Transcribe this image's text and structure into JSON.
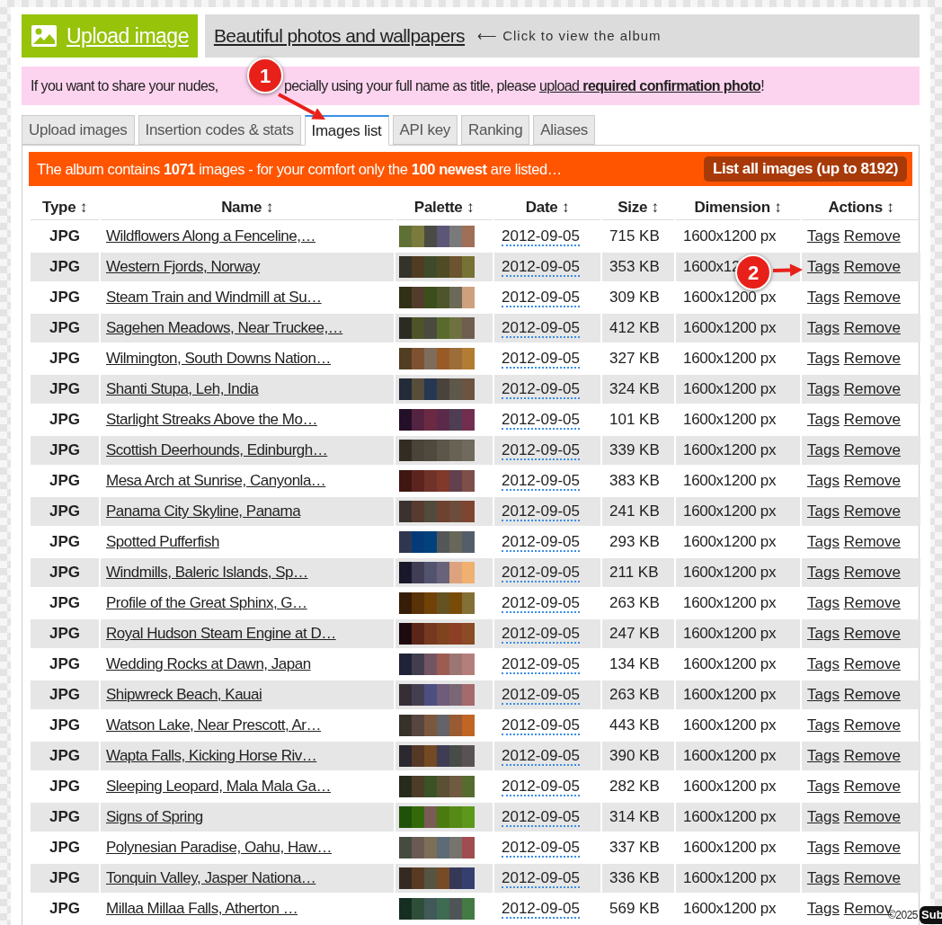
{
  "header": {
    "upload_button": "Upload image",
    "album_title": "Beautiful photos and wallpapers",
    "album_hint": "⟵ Click to view the album"
  },
  "notice": {
    "before_marker": "If you want to share your nudes,",
    "after_marker": "pecially using your full name as title, please",
    "link": "upload **required confirmation photo**",
    "end": "!"
  },
  "tabs": [
    {
      "label": "Upload images",
      "selected": false
    },
    {
      "label": "Insertion codes & stats",
      "selected": false
    },
    {
      "label": "Images list",
      "selected": true
    },
    {
      "label": "API key",
      "selected": false
    },
    {
      "label": "Ranking",
      "selected": false
    },
    {
      "label": "Aliases",
      "selected": false
    }
  ],
  "album_bar": {
    "text": "The album contains **1071** images - for your comfort only the **100 newest** are listed…",
    "button": "List all images (up to 8192)"
  },
  "table": {
    "columns": [
      "Type ↕",
      "Name ↕",
      "Palette ↕",
      "Date ↕",
      "Size ↕",
      "Dimension ↕",
      "Actions ↕"
    ],
    "rows": [
      {
        "type": "JPG",
        "name": "Wildflowers Along a Fenceline,…",
        "palette": [
          {
            "color": "#5f7035"
          },
          {
            "color": "#7a7b3c"
          },
          {
            "color": "#4b4b45"
          },
          {
            "color": "#5c5677"
          },
          {
            "color": "#7a7a7a"
          },
          {
            "color": "#a06f58"
          }
        ],
        "date": "2012-09-05",
        "size": "715 KB",
        "dimension": "1600x1200 px",
        "tags": "Tags",
        "remove": "Remove"
      },
      {
        "type": "JPG",
        "name": "Western Fjords, Norway",
        "palette": [
          {
            "color": "#33332a"
          },
          {
            "color": "#503c22"
          },
          {
            "color": "#3f4a2b"
          },
          {
            "color": "#514b25"
          },
          {
            "color": "#6b542f"
          },
          {
            "color": "#757234"
          }
        ],
        "date": "2012-09-05",
        "size": "353 KB",
        "dimension": "1600x12",
        "tags": "Tags",
        "remove": "Remove"
      },
      {
        "type": "JPG",
        "name": "Steam Train and Windmill at Su…",
        "palette": [
          {
            "color": "#313016"
          },
          {
            "color": "#523d2c"
          },
          {
            "color": "#3b4e1c"
          },
          {
            "color": "#4e552c"
          },
          {
            "color": "#6b6a58"
          },
          {
            "color": "#cda07e"
          }
        ],
        "date": "2012-09-05",
        "size": "309 KB",
        "dimension": "1600x1200 px",
        "tags": "Tags",
        "remove": "Remove"
      },
      {
        "type": "JPG",
        "name": "Sagehen Meadows, Near Truckee,…",
        "palette": [
          {
            "color": "#2b2b22"
          },
          {
            "color": "#4f5328"
          },
          {
            "color": "#4b4a40"
          },
          {
            "color": "#5a6a2c"
          },
          {
            "color": "#6f7141"
          },
          {
            "color": "#6f5e50"
          }
        ],
        "date": "2012-09-05",
        "size": "412 KB",
        "dimension": "1600x1200 px",
        "tags": "Tags",
        "remove": "Remove"
      },
      {
        "type": "JPG",
        "name": "Wilmington, South Downs Nation…",
        "palette": [
          {
            "color": "#513d22"
          },
          {
            "color": "#7e5230"
          },
          {
            "color": "#7e6d5c"
          },
          {
            "color": "#9a5a26"
          },
          {
            "color": "#9c6d38"
          },
          {
            "color": "#b27c33"
          }
        ],
        "date": "2012-09-05",
        "size": "327 KB",
        "dimension": "1600x1200 px",
        "tags": "Tags",
        "remove": "Remove"
      },
      {
        "type": "JPG",
        "name": "Shanti Stupa, Leh, India",
        "palette": [
          {
            "color": "#222b37"
          },
          {
            "color": "#564d3b"
          },
          {
            "color": "#263752"
          },
          {
            "color": "#4a433d"
          },
          {
            "color": "#5d584a"
          },
          {
            "color": "#6b5442"
          }
        ],
        "date": "2012-09-05",
        "size": "324 KB",
        "dimension": "1600x1200 px",
        "tags": "Tags",
        "remove": "Remove"
      },
      {
        "type": "JPG",
        "name": "Starlight Streaks Above the Mo…",
        "palette": [
          {
            "color": "#231028"
          },
          {
            "color": "#532341"
          },
          {
            "color": "#6c2a42"
          },
          {
            "color": "#5b2a4b"
          },
          {
            "color": "#4f3e53"
          },
          {
            "color": "#722e4f"
          }
        ],
        "date": "2012-09-05",
        "size": "101 KB",
        "dimension": "1600x1200 px",
        "tags": "Tags",
        "remove": "Remove"
      },
      {
        "type": "JPG",
        "name": "Scottish Deerhounds, Edinburgh…",
        "palette": [
          {
            "color": "#322c23"
          },
          {
            "color": "#49433a"
          },
          {
            "color": "#4f493e"
          },
          {
            "color": "#5b5649"
          },
          {
            "color": "#676254"
          },
          {
            "color": "#6f6a5d"
          }
        ],
        "date": "2012-09-05",
        "size": "339 KB",
        "dimension": "1600x1200 px",
        "tags": "Tags",
        "remove": "Remove"
      },
      {
        "type": "JPG",
        "name": "Mesa Arch at Sunrise, Canyonla…",
        "palette": [
          {
            "color": "#3f1611"
          },
          {
            "color": "#5d241f"
          },
          {
            "color": "#703229"
          },
          {
            "color": "#80392a"
          },
          {
            "color": "#62404d"
          },
          {
            "color": "#7e4e49"
          }
        ],
        "date": "2012-09-05",
        "size": "383 KB",
        "dimension": "1600x1200 px",
        "tags": "Tags",
        "remove": "Remove"
      },
      {
        "type": "JPG",
        "name": "Panama City Skyline, Panama",
        "palette": [
          {
            "color": "#3b3230"
          },
          {
            "color": "#583b2f"
          },
          {
            "color": "#504b3c"
          },
          {
            "color": "#6d4330"
          },
          {
            "color": "#6d4c3c"
          },
          {
            "color": "#7e4630"
          }
        ],
        "date": "2012-09-05",
        "size": "241 KB",
        "dimension": "1600x1200 px",
        "tags": "Tags",
        "remove": "Remove"
      },
      {
        "type": "JPG",
        "name": "Spotted Pufferfish",
        "palette": [
          {
            "color": "#2f3750"
          },
          {
            "color": "#043a77"
          },
          {
            "color": "#03417d"
          },
          {
            "color": "#545658"
          },
          {
            "color": "#676859"
          },
          {
            "color": "#545e6b"
          }
        ],
        "date": "2012-09-05",
        "size": "293 KB",
        "dimension": "1600x1200 px",
        "tags": "Tags",
        "remove": "Remove"
      },
      {
        "type": "JPG",
        "name": "Windmills, Baleric Islands, Sp…",
        "palette": [
          {
            "color": "#18182a"
          },
          {
            "color": "#413d55"
          },
          {
            "color": "#52546f"
          },
          {
            "color": "#68637a"
          },
          {
            "color": "#dca37e"
          },
          {
            "color": "#efb070"
          }
        ],
        "date": "2012-09-05",
        "size": "211 KB",
        "dimension": "1600x1200 px",
        "tags": "Tags",
        "remove": "Remove"
      },
      {
        "type": "JPG",
        "name": "Profile of the Great Sphinx, G…",
        "palette": [
          {
            "color": "#351d08"
          },
          {
            "color": "#5a3207"
          },
          {
            "color": "#714207"
          },
          {
            "color": "#645223"
          },
          {
            "color": "#784c08"
          },
          {
            "color": "#837034"
          }
        ],
        "date": "2012-09-05",
        "size": "263 KB",
        "dimension": "1600x1200 px",
        "tags": "Tags",
        "remove": "Remove"
      },
      {
        "type": "JPG",
        "name": "Royal Hudson Steam Engine at D…",
        "palette": [
          {
            "color": "#1c0a0e"
          },
          {
            "color": "#5b2618"
          },
          {
            "color": "#753920"
          },
          {
            "color": "#7f4320"
          },
          {
            "color": "#8d3f26"
          },
          {
            "color": "#8a4b25"
          }
        ],
        "date": "2012-09-05",
        "size": "247 KB",
        "dimension": "1600x1200 px",
        "tags": "Tags",
        "remove": "Remove"
      },
      {
        "type": "JPG",
        "name": "Wedding Rocks at Dawn, Japan",
        "palette": [
          {
            "color": "#202238"
          },
          {
            "color": "#433e4d"
          },
          {
            "color": "#735462"
          },
          {
            "color": "#9c5c52"
          },
          {
            "color": "#9c7673"
          },
          {
            "color": "#b47f7a"
          }
        ],
        "date": "2012-09-05",
        "size": "134 KB",
        "dimension": "1600x1200 px",
        "tags": "Tags",
        "remove": "Remove"
      },
      {
        "type": "JPG",
        "name": "Shipwreck Beach, Kauai",
        "palette": [
          {
            "color": "#352f35"
          },
          {
            "color": "#443f50"
          },
          {
            "color": "#4d4f81"
          },
          {
            "color": "#6f5b7a"
          },
          {
            "color": "#7a6775"
          },
          {
            "color": "#a56a6c"
          }
        ],
        "date": "2012-09-05",
        "size": "263 KB",
        "dimension": "1600x1200 px",
        "tags": "Tags",
        "remove": "Remove"
      },
      {
        "type": "JPG",
        "name": "Watson Lake, Near Prescott, Ar…",
        "palette": [
          {
            "color": "#36322a"
          },
          {
            "color": "#574540"
          },
          {
            "color": "#7b573e"
          },
          {
            "color": "#646468"
          },
          {
            "color": "#985b34"
          },
          {
            "color": "#c06523"
          }
        ],
        "date": "2012-09-05",
        "size": "443 KB",
        "dimension": "1600x1200 px",
        "tags": "Tags",
        "remove": "Remove"
      },
      {
        "type": "JPG",
        "name": "Wapta Falls, Kicking Horse Riv…",
        "palette": [
          {
            "color": "#2b2830"
          },
          {
            "color": "#553826"
          },
          {
            "color": "#734a23"
          },
          {
            "color": "#3f3c54"
          },
          {
            "color": "#484c49"
          },
          {
            "color": "#595254"
          }
        ],
        "date": "2012-09-05",
        "size": "390 KB",
        "dimension": "1600x1200 px",
        "tags": "Tags",
        "remove": "Remove"
      },
      {
        "type": "JPG",
        "name": "Sleeping Leopard, Mala Mala Ga…",
        "palette": [
          {
            "color": "#262b1c"
          },
          {
            "color": "#4d3d28"
          },
          {
            "color": "#3b5226"
          },
          {
            "color": "#5b4f34"
          },
          {
            "color": "#705a40"
          },
          {
            "color": "#566c2e"
          }
        ],
        "date": "2012-09-05",
        "size": "282 KB",
        "dimension": "1600x1200 px",
        "tags": "Tags",
        "remove": "Remove"
      },
      {
        "type": "JPG",
        "name": "Signs of Spring",
        "palette": [
          {
            "color": "#205109"
          },
          {
            "color": "#346809"
          },
          {
            "color": "#7a5b55"
          },
          {
            "color": "#497b10"
          },
          {
            "color": "#568a16"
          },
          {
            "color": "#5c981b"
          }
        ],
        "date": "2012-09-05",
        "size": "314 KB",
        "dimension": "1600x1200 px",
        "tags": "Tags",
        "remove": "Remove"
      },
      {
        "type": "JPG",
        "name": "Polynesian Paradise, Oahu, Haw…",
        "palette": [
          {
            "color": "#464b40"
          },
          {
            "color": "#6a5a53"
          },
          {
            "color": "#7c6f58"
          },
          {
            "color": "#5e6b77"
          },
          {
            "color": "#77746e"
          },
          {
            "color": "#a14c50"
          }
        ],
        "date": "2012-09-05",
        "size": "337 KB",
        "dimension": "1600x1200 px",
        "tags": "Tags",
        "remove": "Remove"
      },
      {
        "type": "JPG",
        "name": "Tonquin Valley, Jasper Nationa…",
        "palette": [
          {
            "color": "#352a22"
          },
          {
            "color": "#583b22"
          },
          {
            "color": "#565442"
          },
          {
            "color": "#784b27"
          },
          {
            "color": "#363857"
          },
          {
            "color": "#36406f"
          }
        ],
        "date": "2012-09-05",
        "size": "336 KB",
        "dimension": "1600x1200 px",
        "tags": "Tags",
        "remove": "Remove"
      },
      {
        "type": "JPG",
        "name": "Millaa Millaa Falls, Atherton …",
        "palette": [
          {
            "color": "#162e21"
          },
          {
            "color": "#2f4e39"
          },
          {
            "color": "#415958"
          },
          {
            "color": "#3e6b52"
          },
          {
            "color": "#4f5556"
          },
          {
            "color": "#447a43"
          }
        ],
        "date": "2012-09-05",
        "size": "569 KB",
        "dimension": "1600x1200 px",
        "tags": "Tags",
        "remove": "Remov"
      }
    ]
  },
  "callouts": [
    {
      "label": "1"
    },
    {
      "label": "2"
    }
  ],
  "footer": {
    "copyright": "©2025",
    "badge": "Sub"
  }
}
